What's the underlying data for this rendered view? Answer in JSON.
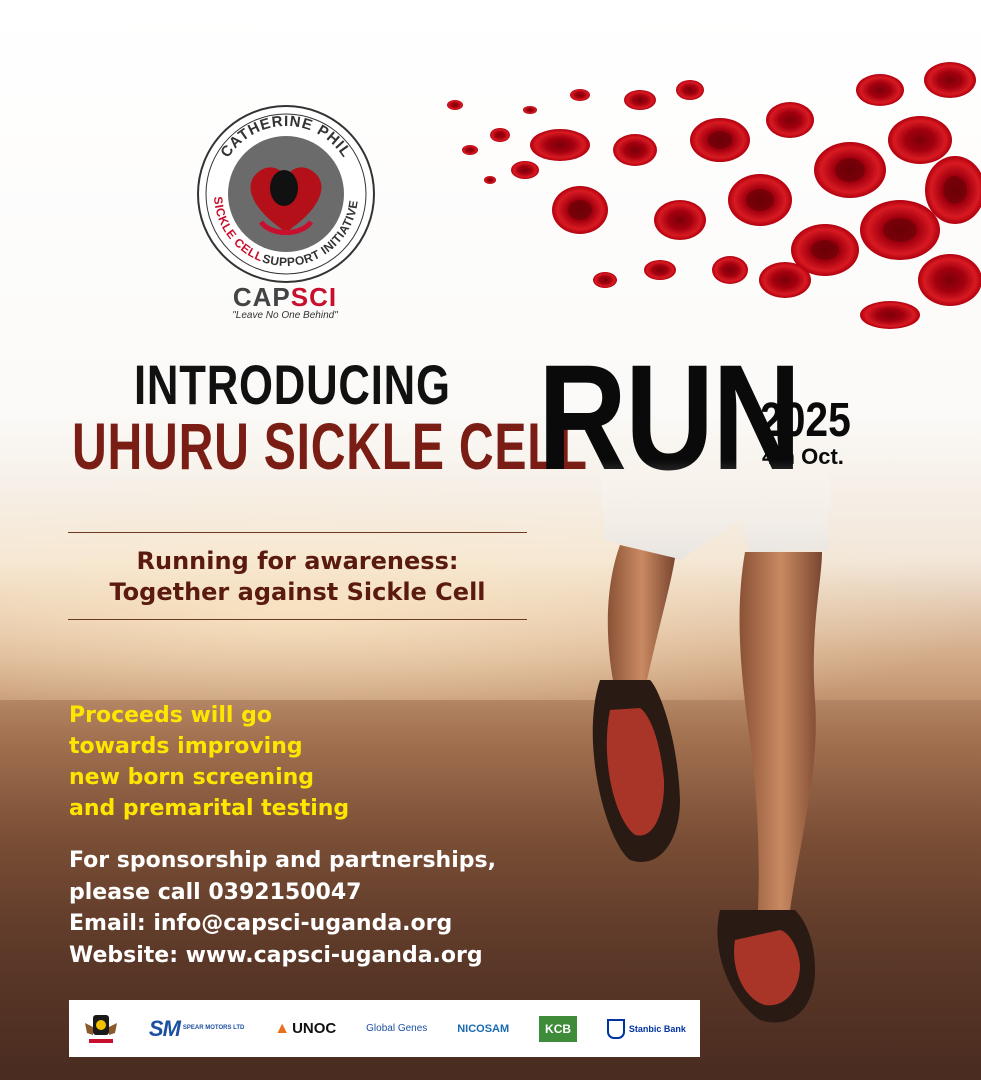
{
  "logo": {
    "arc_text_top": "CATHERINE PHIL",
    "arc_text_left": "SICKLE CELL",
    "arc_text_right": "SUPPORT INITIATIVE",
    "abbr_part1": "CAP",
    "abbr_part2": "SCI",
    "tagline": "\"Leave No One Behind\""
  },
  "headline": {
    "intro": "INTRODUCING",
    "event_name": "UHURU SICKLE CELL",
    "run": "RUN",
    "year": "2025",
    "date": "4th Oct."
  },
  "tagline": {
    "line1": "Running for awareness:",
    "line2": "Together against Sickle Cell"
  },
  "proceeds": {
    "lines": [
      "Proceeds will go",
      "towards improving",
      "new born screening",
      "and premarital testing"
    ]
  },
  "contact": {
    "lines": [
      "For sponsorship and partnerships,",
      "please call 0392150047",
      "Email: info@capsci-uganda.org",
      "Website: www.capsci-uganda.org"
    ]
  },
  "sponsors": {
    "spear_mark": "SM",
    "spear_name": "SPEAR MOTORS LTD",
    "unoc": "UNOC",
    "global_genes": "Global Genes",
    "nicosam": "NICOSAM",
    "kcb": "KCB",
    "stanbic": "Stanbic Bank"
  },
  "colors": {
    "accent_red": "#c8102e",
    "headline_maroon": "#7a1d14",
    "proceeds_yellow": "#ffe600"
  }
}
